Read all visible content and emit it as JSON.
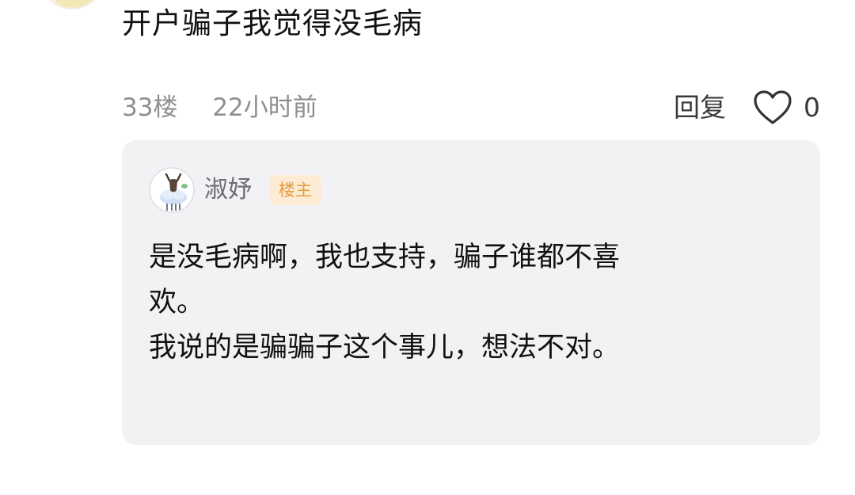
{
  "comment": {
    "text": "开户骗子我觉得没毛病",
    "floor": "33楼",
    "time": "22小时前",
    "reply_label": "回复",
    "like_count": "0"
  },
  "reply": {
    "author": "淑妤",
    "badge": "楼主",
    "lines": [
      "是没毛病啊，我也支持，骗子谁都不喜",
      "欢。",
      "我说的是骗骗子这个事儿，想法不对。"
    ]
  },
  "icons": {
    "like": "heart-outline-icon",
    "avatar": "goat-avatar"
  },
  "colors": {
    "badge_bg": "#fbecd3",
    "badge_text": "#e89a3c",
    "card_bg": "#f2f2f5",
    "meta_text": "#8e8e93"
  }
}
